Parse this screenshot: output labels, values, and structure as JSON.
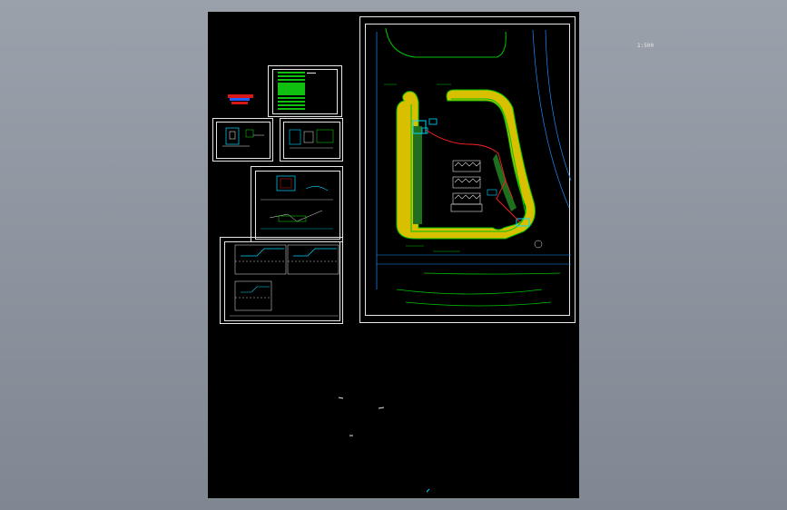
{
  "viewer": {
    "background_color": "#8a919b",
    "canvas_color": "#000000"
  },
  "drawing": {
    "scale_label": "1:500",
    "colors": {
      "frame": "#e6e6e6",
      "landscape": "#00c000",
      "hatch": "#d8c000",
      "roads": "#1a8cff",
      "cyan": "#00d8ff",
      "red": "#ff2020",
      "table": "#10e010"
    }
  },
  "sheets": [
    {
      "name": "sheet-cover-table"
    },
    {
      "name": "sheet-legend-stamp"
    },
    {
      "name": "sheet-detail-1"
    },
    {
      "name": "sheet-detail-2"
    },
    {
      "name": "sheet-detail-3"
    },
    {
      "name": "sheet-profile-sections"
    },
    {
      "name": "sheet-site-plan"
    }
  ]
}
